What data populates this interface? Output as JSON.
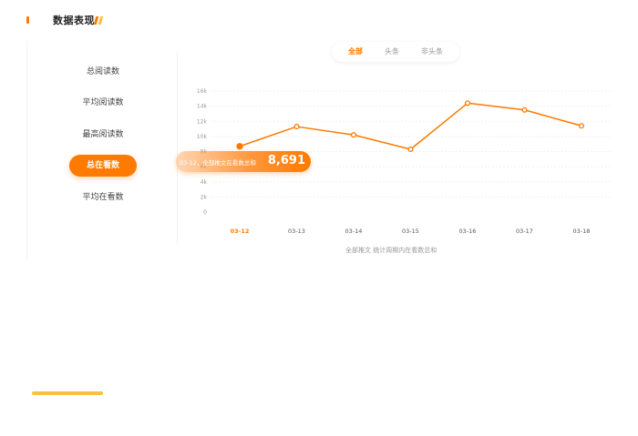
{
  "header": {
    "title": "数据表现",
    "accent_color": "#ff7a00",
    "deco_colors": [
      "#ff7a00",
      "#f7c33c"
    ]
  },
  "metrics_nav": {
    "items": [
      {
        "label": "总阅读数",
        "active": false
      },
      {
        "label": "平均阅读数",
        "active": false
      },
      {
        "label": "最高阅读数",
        "active": false
      },
      {
        "label": "总在看数",
        "active": true
      },
      {
        "label": "平均在看数",
        "active": false
      }
    ]
  },
  "filter_tabs": [
    {
      "label": "全部",
      "active": true
    },
    {
      "label": "头条",
      "active": false
    },
    {
      "label": "非头条",
      "active": false
    }
  ],
  "tooltip": {
    "label": "03-12，全部推文在看数总和",
    "value": "8,691"
  },
  "chart_caption": "全部推文 统计周期内在看数总和",
  "chart_data": {
    "type": "line",
    "categories": [
      "03-12",
      "03-13",
      "03-14",
      "03-15",
      "03-16",
      "03-17",
      "03-18"
    ],
    "values": [
      8691,
      11300,
      10200,
      8300,
      14400,
      13500,
      11400
    ],
    "y_ticks": [
      "0",
      "2k",
      "4k",
      "6k",
      "8k",
      "10k",
      "12k",
      "14k",
      "16k"
    ],
    "ylim": [
      0,
      16000
    ],
    "highlight_index": 0,
    "line_color": "#ff7a00",
    "grid": true
  }
}
